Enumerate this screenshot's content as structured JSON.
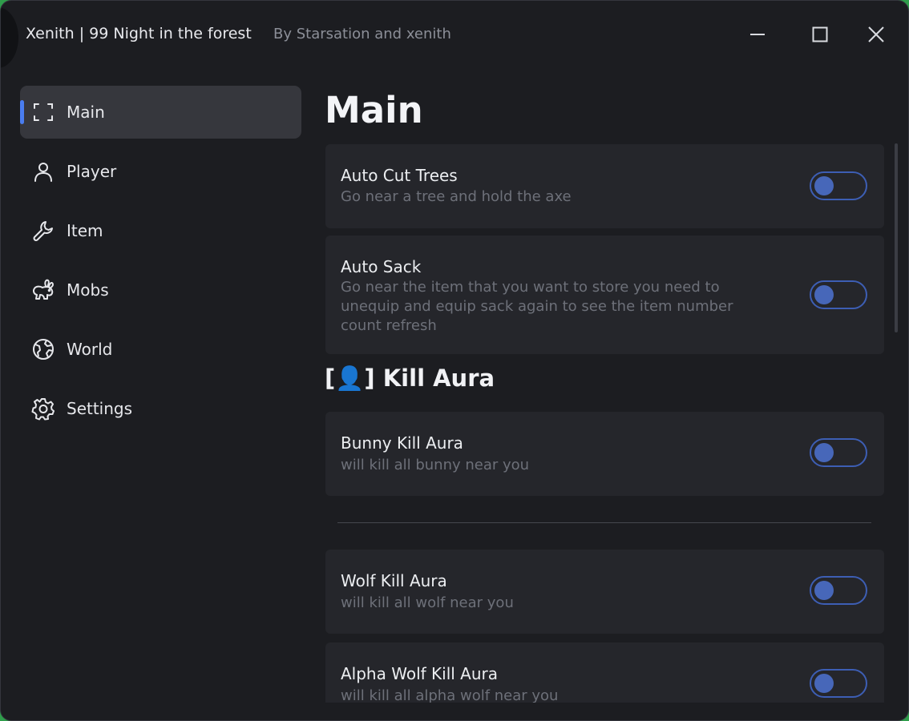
{
  "window": {
    "title": "Xenith | 99 Night in the forest",
    "subtitle": "By Starsation and xenith",
    "controls": {
      "minimize": "minimize-icon",
      "maximize": "maximize-icon",
      "close": "close-icon"
    }
  },
  "sidebar": {
    "items": [
      {
        "label": "Main",
        "icon": "scan-frame-icon",
        "active": true
      },
      {
        "label": "Player",
        "icon": "user-icon",
        "active": false
      },
      {
        "label": "Item",
        "icon": "wrench-icon",
        "active": false
      },
      {
        "label": "Mobs",
        "icon": "rabbit-icon",
        "active": false
      },
      {
        "label": "World",
        "icon": "globe-icon",
        "active": false
      },
      {
        "label": "Settings",
        "icon": "gear-icon",
        "active": false
      }
    ]
  },
  "main": {
    "title": "Main",
    "toggles": [
      {
        "title": "Auto Cut Trees",
        "description": "Go near a tree and hold the axe",
        "enabled": false
      },
      {
        "title": "Auto Sack",
        "description": "Go near the item that you want to store you need to unequip and equip sack again to see the item number count refresh",
        "enabled": false
      }
    ],
    "kill_aura_section": {
      "heading": "[👤] Kill Aura",
      "toggles": [
        {
          "title": "Bunny Kill Aura",
          "description": "will kill all bunny near you",
          "enabled": false
        },
        {
          "title": "Wolf Kill Aura",
          "description": "will kill all wolf near you",
          "enabled": false
        },
        {
          "title": "Alpha Wolf Kill Aura",
          "description": "will kill all alpha wolf near you",
          "enabled": false
        }
      ]
    }
  },
  "colors": {
    "background": "#1c1d21",
    "card": "#25262b",
    "accent": "#4a7df0",
    "toggle": "#3d5eb4",
    "outer": "#2f9e4b"
  }
}
